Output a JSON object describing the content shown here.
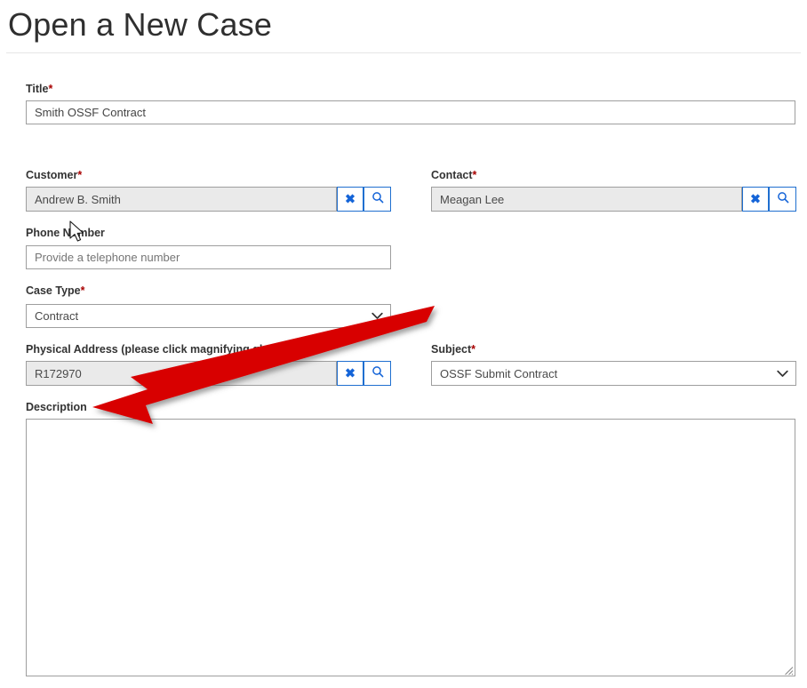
{
  "header": {
    "title": "Open a New Case"
  },
  "form": {
    "title_field": {
      "label": "Title",
      "required_marker": "*",
      "value": "Smith OSSF Contract"
    },
    "customer_field": {
      "label": "Customer",
      "required_marker": "*",
      "value": "Andrew B. Smith",
      "clear_icon": "x-icon",
      "search_icon": "magnifying-glass-icon"
    },
    "contact_field": {
      "label": "Contact",
      "required_marker": "*",
      "value": "Meagan Lee",
      "clear_icon": "x-icon",
      "search_icon": "magnifying-glass-icon"
    },
    "phone_field": {
      "label": "Phone Number",
      "required_marker": "",
      "value": "",
      "placeholder": "Provide a telephone number"
    },
    "case_type_field": {
      "label": "Case Type",
      "required_marker": "*",
      "value": "Contract",
      "chevron_icon": "chevron-down-icon"
    },
    "physical_address_field": {
      "label": "Physical Address (please click magnifying glass)",
      "required_marker": "",
      "value": "R172970",
      "clear_icon": "x-icon",
      "search_icon": "magnifying-glass-icon"
    },
    "subject_field": {
      "label": "Subject",
      "required_marker": "*",
      "value": "OSSF Submit Contract",
      "chevron_icon": "chevron-down-icon"
    },
    "description_field": {
      "label": "Description",
      "required_marker": "",
      "value": "",
      "placeholder": ""
    }
  },
  "annotations": {
    "arrow": {
      "color": "#d80000",
      "name": "red-pointer-arrow",
      "points_to": "Description"
    },
    "cursor": {
      "name": "mouse-pointer",
      "over": "Phone Number"
    }
  },
  "colors": {
    "required_star": "#a80000",
    "lookup_button_border": "#1f6fd0",
    "lookup_icon": "#1464d8",
    "field_border": "#9e9e9e",
    "readonly_field_bg": "#eaeaea",
    "arrow_red": "#d80000"
  }
}
